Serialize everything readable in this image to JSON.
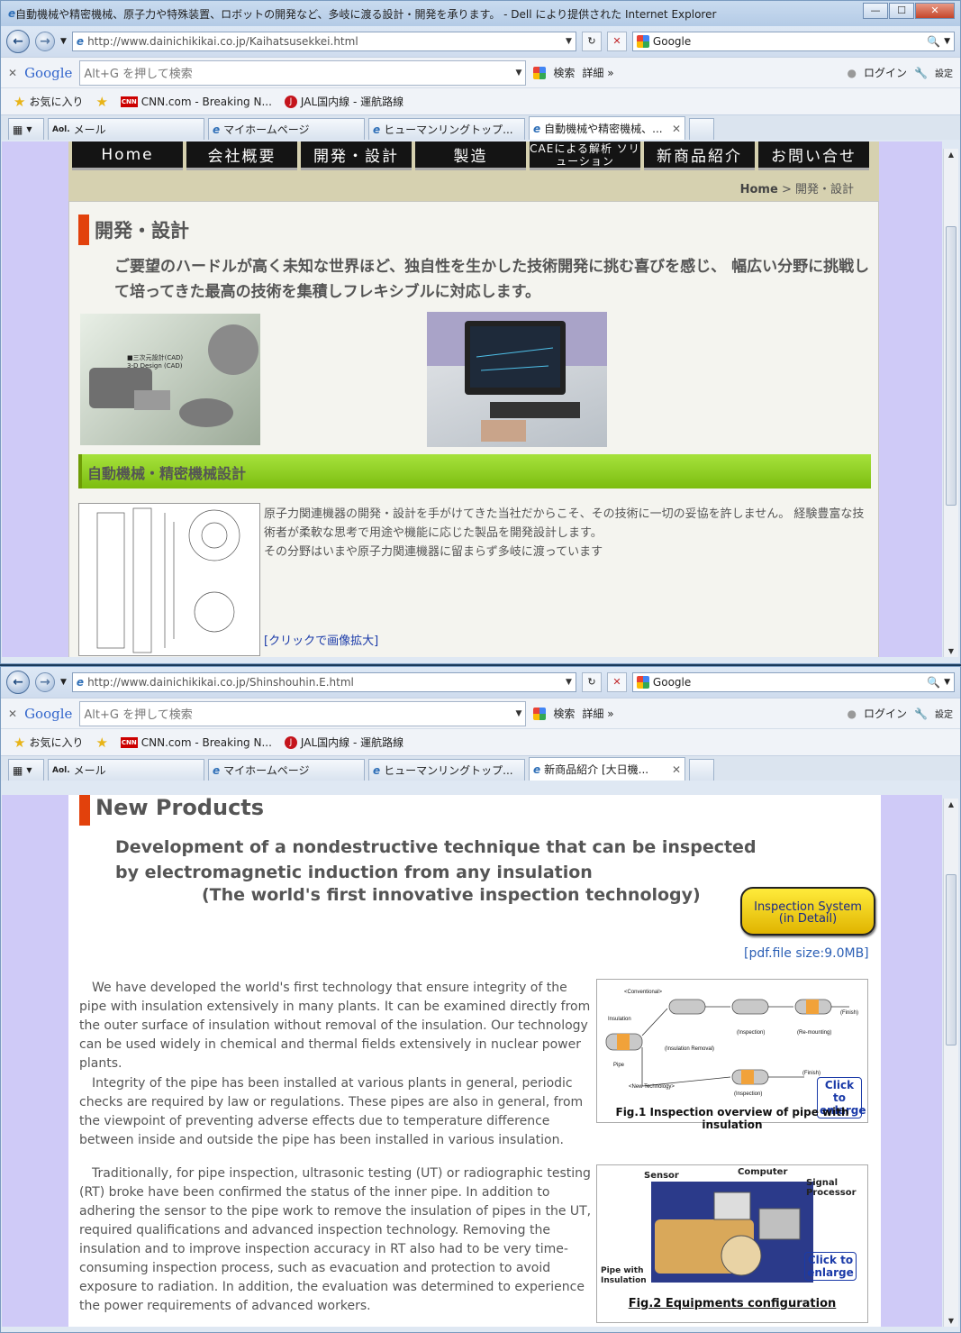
{
  "win1": {
    "title": "自動機械や精密機械、原子力や特殊装置、ロボットの開発など、多岐に渡る設計・開発を承ります。 - Dell により提供された Internet Explorer",
    "url": "http://www.dainichikikai.co.jp/Kaihatsusekkei.html",
    "search_engine": "Google",
    "google_bar": {
      "logo": "Google",
      "placeholder": "Alt+G を押して検索",
      "search_btn": "検索",
      "more": "詳細 »",
      "login": "ログイン",
      "settings": "設定"
    },
    "favorites": {
      "label": "お気に入り",
      "items": [
        "CNN.com - Breaking N...",
        "JAL国内線 - 運航路線"
      ]
    },
    "tabs": [
      "メール",
      "マイホームページ",
      "ヒューマンリングトップ...",
      "自動機械や精密機械、..."
    ],
    "page": {
      "nav": [
        "Home",
        "会社概要",
        "開発・設計",
        "製造",
        "CAEによる解析 ソリューション",
        "新商品紹介",
        "お問い合せ"
      ],
      "breadcrumb_home": "Home",
      "breadcrumb_sep": ">",
      "breadcrumb_current": "開発・設計",
      "heading": "開発・設計",
      "lead": "ご要望のハードルが高く未知な世界ほど、独自性を生かした技術開発に挑む喜びを感じ、 幅広い分野に挑戦して培ってきた最高の技術を集積しフレキシブルに対応します。",
      "image1_caption": "■三次元設計(CAD)\n3-D Design (CAD)",
      "section_title": "自動機械・精密機械設計",
      "section_text": "原子力関連機器の開発・設計を手がけてきた当社だからこそ、その技術に一切の妥協を許しません。 経験豊富な技術者が柔軟な思考で用途や機能に応じた製品を開発設計します。\nその分野はいまや原子力関連機器に留まらず多岐に渡っています",
      "enlarge_link": "[クリックで画像拡大]"
    }
  },
  "win2": {
    "url": "http://www.dainichikikai.co.jp/Shinshouhin.E.html",
    "search_engine": "Google",
    "google_bar": {
      "logo": "Google",
      "placeholder": "Alt+G を押して検索",
      "search_btn": "検索",
      "more": "詳細 »",
      "login": "ログイン",
      "settings": "設定"
    },
    "favorites": {
      "label": "お気に入り",
      "items": [
        "CNN.com - Breaking N...",
        "JAL国内線 - 運航路線"
      ]
    },
    "tabs": [
      "メール",
      "マイホームページ",
      "ヒューマンリングトップ...",
      "新商品紹介 [大日機..."
    ],
    "page": {
      "title": "New Products",
      "sub1": "Development of a nondestructive technique that can be inspected by electromagnetic induction from any insulation",
      "sub2": "(The world's first innovative inspection technology)",
      "inspection_btn_line1": "Inspection System",
      "inspection_btn_line2": "(in Detail)",
      "pdf_link": "[pdf.file size:9.0MB]",
      "para1": "We have developed the world's first technology that ensure integrity of the pipe with insulation extensively in many plants. It can be examined directly from the outer surface of insulation without removal of the insulation. Our technology can be used widely in chemical and thermal fields extensively in nuclear power plants.",
      "para2": "Integrity of the pipe has been installed at various plants in general, periodic checks are required by law or regulations. These pipes are also in general, from the viewpoint of preventing adverse effects due to temperature difference between inside and outside the pipe has been installed in various insulation.",
      "para3": "Traditionally, for pipe inspection, ultrasonic testing (UT) or radiographic testing (RT) broke have been confirmed the status of the inner pipe. In addition to adhering the sensor to the pipe work to remove the insulation of pipes in the UT, required qualifications and advanced inspection technology. Removing the insulation and to improve inspection accuracy in RT also had to be very time-consuming inspection process, such as evacuation and protection to avoid exposure to radiation. In addition, the evaluation was determined to experience the power requirements of advanced workers.",
      "fig1": {
        "caption": "Fig.1 Inspection overview of pipe with insulation",
        "labels": {
          "conventional": "<Conventional>",
          "insulation": "Insulation",
          "pipe": "Pipe",
          "ins_removal": "(Insulation Removal)",
          "inspection": "(Inspection)",
          "remounting": "(Re-mounting)",
          "finish": "(Finish)",
          "new_tech": "<New Technology>"
        },
        "enlarge": "Click to enlarge"
      },
      "fig2": {
        "caption": "Fig.2 Equipments configuration",
        "labels": {
          "sensor": "Sensor",
          "computer": "Computer",
          "signal": "Signal Processor",
          "pipe": "Pipe with Insulation"
        },
        "enlarge": "Click to enlarge"
      }
    }
  }
}
